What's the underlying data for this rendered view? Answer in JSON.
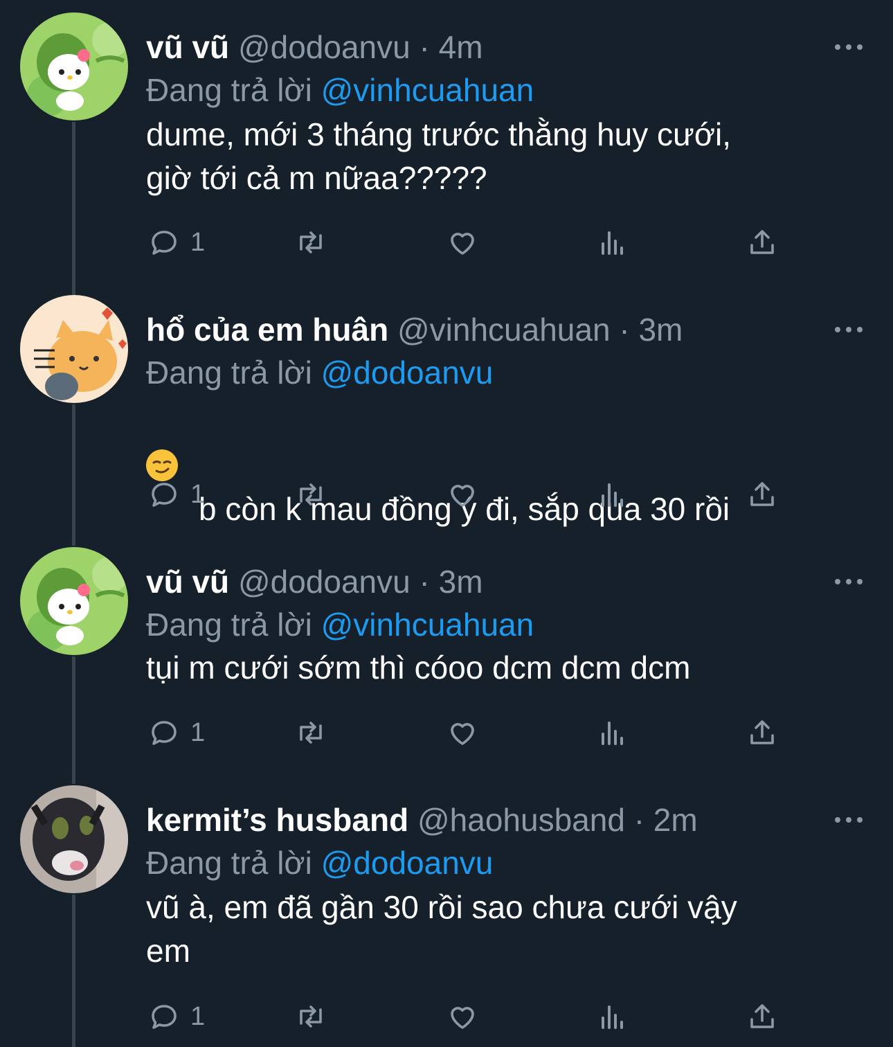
{
  "labels": {
    "replying_to": "Đang trả lời"
  },
  "tweets": [
    {
      "name": "vũ vũ",
      "handle": "@dodoanvu",
      "time": "4m",
      "reply_to": "@vinhcuahuan",
      "text": "dume, mới 3 tháng trước thằng huy cưới,\ngiờ tới cả m nữaa?????",
      "replies": "1",
      "avatar": "kitty-green"
    },
    {
      "name": "hổ của em huân",
      "handle": "@vinhcuahuan",
      "time": "3m",
      "reply_to": "@dodoanvu",
      "emoji": "smirking-face-emoji",
      "text": "b còn k mau đồng ý đi, sắp qua 30 rồi",
      "replies": "1",
      "avatar": "cat-cartoon"
    },
    {
      "name": "vũ vũ",
      "handle": "@dodoanvu",
      "time": "3m",
      "reply_to": "@vinhcuahuan",
      "text": "tụi m cưới sớm thì cóoo dcm dcm dcm",
      "replies": "1",
      "avatar": "kitty-green"
    },
    {
      "name": "kermit’s husband",
      "handle": "@haohusband",
      "time": "2m",
      "reply_to": "@dodoanvu",
      "text": "vũ à, em đã gần 30 rồi sao chưa cưới vậy\nem",
      "replies": "1",
      "avatar": "cat-photo"
    }
  ],
  "meta": {
    "separator": "·"
  },
  "colors": {
    "background": "#15202b",
    "secondary": "#8b98a5",
    "link": "#1d9bf0"
  }
}
